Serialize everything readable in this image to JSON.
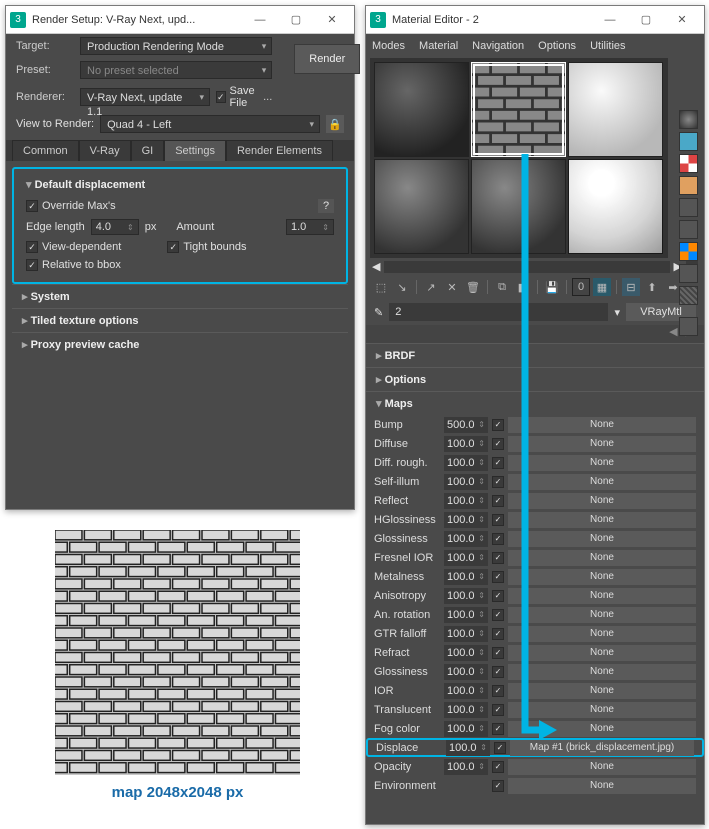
{
  "rs": {
    "title": "Render Setup: V-Ray Next, upd...",
    "targetLbl": "Target:",
    "targetVal": "Production Rendering Mode",
    "presetLbl": "Preset:",
    "presetVal": "No preset selected",
    "rendererLbl": "Renderer:",
    "rendererVal": "V-Ray Next, update 1.1",
    "saveFile": "Save File",
    "renderBtn": "Render",
    "viewLbl": "View to Render:",
    "viewVal": "Quad 4 - Left",
    "tabs": [
      "Common",
      "V-Ray",
      "GI",
      "Settings",
      "Render Elements"
    ],
    "dispHdr": "Default displacement",
    "override": "Override Max's",
    "edgeLbl": "Edge length",
    "edgeVal": "4.0",
    "pxLbl": "px",
    "amtLbl": "Amount",
    "amtVal": "1.0",
    "viewDep": "View-dependent",
    "tight": "Tight bounds",
    "rel": "Relative to bbox",
    "sys": "System",
    "tiled": "Tiled texture options",
    "proxy": "Proxy preview cache"
  },
  "me": {
    "title": "Material Editor - 2",
    "menus": [
      "Modes",
      "Material",
      "Navigation",
      "Options",
      "Utilities"
    ],
    "matNum": "2",
    "matType": "VRayMtl",
    "brdf": "BRDF",
    "opts": "Options",
    "maps": "Maps",
    "rows": [
      {
        "n": "Bump",
        "v": "500.0",
        "m": "None"
      },
      {
        "n": "Diffuse",
        "v": "100.0",
        "m": "None"
      },
      {
        "n": "Diff. rough.",
        "v": "100.0",
        "m": "None"
      },
      {
        "n": "Self-illum",
        "v": "100.0",
        "m": "None"
      },
      {
        "n": "Reflect",
        "v": "100.0",
        "m": "None"
      },
      {
        "n": "HGlossiness",
        "v": "100.0",
        "m": "None"
      },
      {
        "n": "Glossiness",
        "v": "100.0",
        "m": "None"
      },
      {
        "n": "Fresnel IOR",
        "v": "100.0",
        "m": "None"
      },
      {
        "n": "Metalness",
        "v": "100.0",
        "m": "None"
      },
      {
        "n": "Anisotropy",
        "v": "100.0",
        "m": "None"
      },
      {
        "n": "An. rotation",
        "v": "100.0",
        "m": "None"
      },
      {
        "n": "GTR falloff",
        "v": "100.0",
        "m": "None"
      },
      {
        "n": "Refract",
        "v": "100.0",
        "m": "None"
      },
      {
        "n": "Glossiness",
        "v": "100.0",
        "m": "None"
      },
      {
        "n": "IOR",
        "v": "100.0",
        "m": "None"
      },
      {
        "n": "Translucent",
        "v": "100.0",
        "m": "None"
      },
      {
        "n": "Fog color",
        "v": "100.0",
        "m": "None"
      },
      {
        "n": "Displace",
        "v": "100.0",
        "m": "Map #1 (brick_displacement.jpg)",
        "hl": true
      },
      {
        "n": "Opacity",
        "v": "100.0",
        "m": "None"
      },
      {
        "n": "Environment",
        "v": "",
        "m": "None"
      }
    ]
  },
  "caption": "map 2048x2048 px"
}
